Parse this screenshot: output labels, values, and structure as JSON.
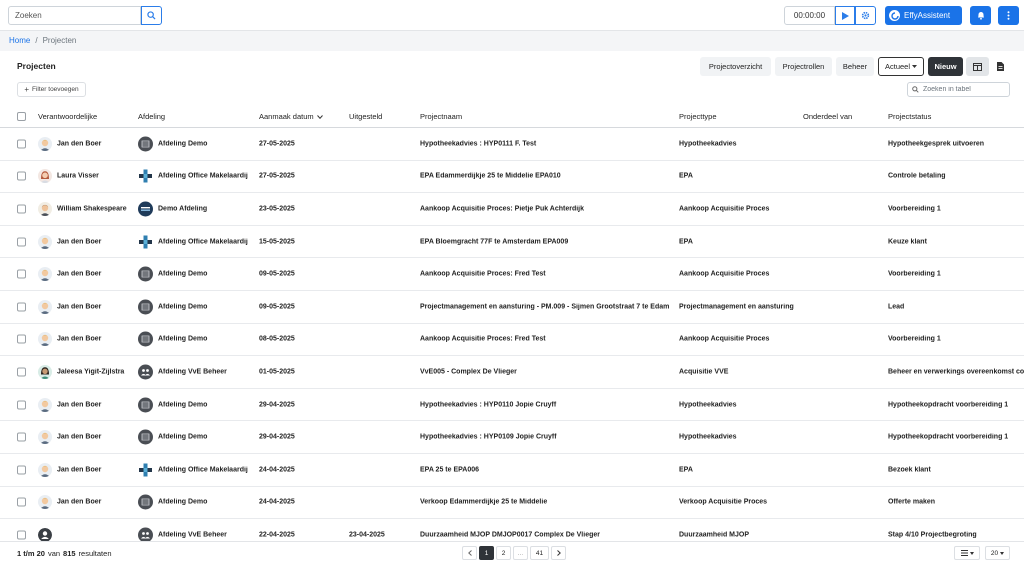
{
  "topbar": {
    "search_placeholder": "Zoeken",
    "timer": "00:00:00",
    "assistant_label": "EffyAssistent"
  },
  "breadcrumb": {
    "home": "Home",
    "separator": "/",
    "current": "Projecten"
  },
  "header": {
    "title": "Projecten",
    "btn_overview": "Projectoverzicht",
    "btn_roles": "Projectrollen",
    "btn_manage": "Beheer",
    "btn_actueel": "Actueel",
    "btn_new": "Nieuw"
  },
  "toolbar": {
    "filter_label": "Filter toevoegen",
    "table_search_placeholder": "Zoeken in tabel"
  },
  "columns": {
    "responsible": "Verantwoordelijke",
    "department": "Afdeling",
    "created": "Aanmaak datum",
    "postponed": "Uitgesteld",
    "project_name": "Projectnaam",
    "project_type": "Projecttype",
    "part_of": "Onderdeel van",
    "status": "Projectstatus"
  },
  "rows": [
    {
      "person": "Jan den Boer",
      "avatar": "man-blond",
      "dept": "Afdeling Demo",
      "dept_icon": "demo-logo",
      "created": "27-05-2025",
      "postponed": "",
      "name": "Hypotheekadvies : HYP0111 F. Test",
      "type": "Hypotheekadvies",
      "part_of": "",
      "status": "Hypotheekgesprek uitvoeren"
    },
    {
      "person": "Laura Visser",
      "avatar": "woman-red",
      "dept": "Afdeling Office Makelaardij",
      "dept_icon": "cross-logo",
      "created": "27-05-2025",
      "postponed": "",
      "name": "EPA Edammerdijkje 25 te Middelie EPA010",
      "type": "EPA",
      "part_of": "",
      "status": "Controle betaling"
    },
    {
      "person": "William Shakespeare",
      "avatar": "man-brown",
      "dept": "Demo Afdeling",
      "dept_icon": "your-logo",
      "created": "23-05-2025",
      "postponed": "",
      "name": "Aankoop Acquisitie Proces: Pietje Puk Achterdijk",
      "type": "Aankoop Acquisitie Proces",
      "part_of": "",
      "status": "Voorbereiding 1"
    },
    {
      "person": "Jan den Boer",
      "avatar": "man-blond",
      "dept": "Afdeling Office Makelaardij",
      "dept_icon": "cross-logo",
      "created": "15-05-2025",
      "postponed": "",
      "name": "EPA Bloemgracht 77F te Amsterdam EPA009",
      "type": "EPA",
      "part_of": "",
      "status": "Keuze klant"
    },
    {
      "person": "Jan den Boer",
      "avatar": "man-blond",
      "dept": "Afdeling Demo",
      "dept_icon": "demo-logo",
      "created": "09-05-2025",
      "postponed": "",
      "name": "Aankoop Acquisitie Proces: Fred Test",
      "type": "Aankoop Acquisitie Proces",
      "part_of": "",
      "status": "Voorbereiding 1"
    },
    {
      "person": "Jan den Boer",
      "avatar": "man-blond",
      "dept": "Afdeling Demo",
      "dept_icon": "demo-logo",
      "created": "09-05-2025",
      "postponed": "",
      "name": "Projectmanagement en aansturing - PM.009 - Sijmen Grootstraat 7 te Edam",
      "type": "Projectmanagement en aansturing",
      "part_of": "",
      "status": "Lead"
    },
    {
      "person": "Jan den Boer",
      "avatar": "man-blond",
      "dept": "Afdeling Demo",
      "dept_icon": "demo-logo",
      "created": "08-05-2025",
      "postponed": "",
      "name": "Aankoop Acquisitie Proces: Fred Test",
      "type": "Aankoop Acquisitie Proces",
      "part_of": "",
      "status": "Voorbereiding 1"
    },
    {
      "person": "Jaleesa Yigit-Zijlstra",
      "avatar": "woman-dark",
      "dept": "Afdeling VvE Beheer",
      "dept_icon": "people-logo",
      "created": "01-05-2025",
      "postponed": "",
      "name": "VvE005 - Complex De Vlieger",
      "type": "Acquisitie VVE",
      "part_of": "",
      "status": "Beheer en verwerkings overeenkomst con"
    },
    {
      "person": "Jan den Boer",
      "avatar": "man-blond",
      "dept": "Afdeling Demo",
      "dept_icon": "demo-logo",
      "created": "29-04-2025",
      "postponed": "",
      "name": "Hypotheekadvies : HYP0110 Jopie Cruyff",
      "type": "Hypotheekadvies",
      "part_of": "",
      "status": "Hypotheekopdracht voorbereiding 1"
    },
    {
      "person": "Jan den Boer",
      "avatar": "man-blond",
      "dept": "Afdeling Demo",
      "dept_icon": "demo-logo",
      "created": "29-04-2025",
      "postponed": "",
      "name": "Hypotheekadvies : HYP0109 Jopie Cruyff",
      "type": "Hypotheekadvies",
      "part_of": "",
      "status": "Hypotheekopdracht voorbereiding 1"
    },
    {
      "person": "Jan den Boer",
      "avatar": "man-blond",
      "dept": "Afdeling Office Makelaardij",
      "dept_icon": "cross-logo",
      "created": "24-04-2025",
      "postponed": "",
      "name": "EPA 25 te EPA006",
      "type": "EPA",
      "part_of": "",
      "status": "Bezoek klant"
    },
    {
      "person": "Jan den Boer",
      "avatar": "man-blond",
      "dept": "Afdeling Demo",
      "dept_icon": "demo-logo",
      "created": "24-04-2025",
      "postponed": "",
      "name": "Verkoop Edammerdijkje 25 te Middelie",
      "type": "Verkoop Acquisitie Proces",
      "part_of": "",
      "status": "Offerte maken"
    },
    {
      "person": "",
      "avatar": "default-user",
      "dept": "Afdeling VvE Beheer",
      "dept_icon": "people-logo",
      "created": "22-04-2025",
      "postponed": "23-04-2025",
      "name": "Duurzaamheid MJOP DMJOP0017 Complex De Vlieger",
      "type": "Duurzaamheid MJOP",
      "part_of": "",
      "status": "Stap 4/10 Projectbegroting"
    }
  ],
  "footer": {
    "range": "1 t/m 20",
    "of_word": "van",
    "total": "815",
    "results_word": "resultaten",
    "pages": [
      "1",
      "2",
      "...",
      "41"
    ],
    "page_size": "20"
  },
  "colors": {
    "primary": "#1a73e8",
    "dark": "#2f3338"
  }
}
